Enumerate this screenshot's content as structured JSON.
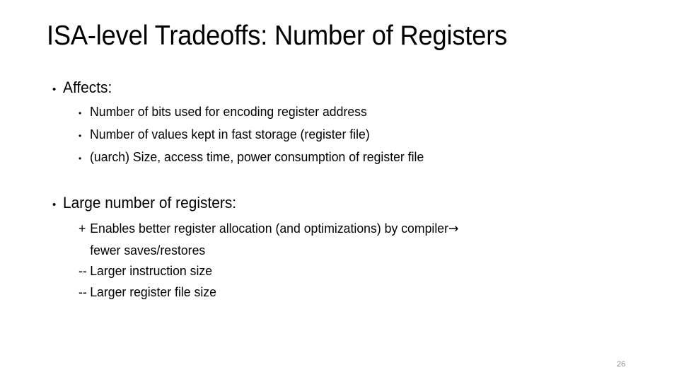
{
  "slide": {
    "title": "ISA-level Tradeoffs: Number of Registers",
    "page_number": "26",
    "text_color": "#000000",
    "background_color": "#ffffff",
    "page_number_color": "#8d8d8d",
    "bullet_glyph": "•",
    "arrow_glyph": "→"
  },
  "content": {
    "affects": {
      "heading": "Affects:",
      "items": [
        "Number of bits used for encoding register address",
        "Number of values kept in fast storage (register file)",
        "(uarch) Size, access time, power consumption of register file"
      ]
    },
    "large_registers": {
      "heading": "Large number of registers:",
      "pro": {
        "marker": "+",
        "line1": "Enables better register allocation (and optimizations) by compiler",
        "line2": "fewer saves/restores"
      },
      "cons": [
        {
          "marker": "--",
          "text": "Larger instruction size"
        },
        {
          "marker": "--",
          "text": "Larger register file size"
        }
      ]
    }
  }
}
